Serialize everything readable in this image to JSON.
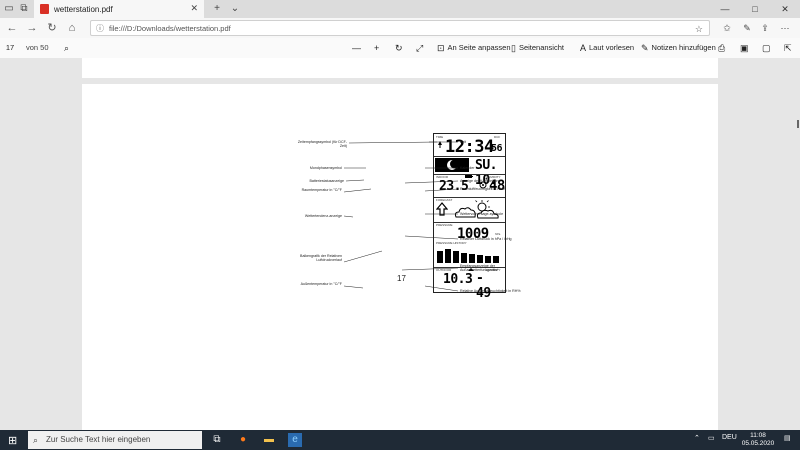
{
  "browser": {
    "tab_title": "wetterstation.pdf",
    "url": "file:///D:/Downloads/wetterstation.pdf"
  },
  "pdf_toolbar": {
    "page_current": "17",
    "page_total": "von 50",
    "fit_label": "An Seite anpassen",
    "page_view_label": "Seitenansicht",
    "read_aloud_label": "Laut vorlesen",
    "notes_label": "Notizen hinzufügen"
  },
  "document": {
    "page_number": "17",
    "device": {
      "time_label": "TIME",
      "dcf_label": "DCF",
      "time": "12:34",
      "seconds": "56",
      "weekday_date": "SU. 10.",
      "indoor_label": "INDOOR",
      "humidity_label": "HUMIDITY",
      "indoor_temp": "23.5",
      "indoor_humidity": "48",
      "forecast_label": "FORECAST",
      "pressure_label": "PRESSURE",
      "pressure_value": "1009",
      "pressure_unit": "hPa",
      "history_label": "PRESSURE HISTORY",
      "outdoor_label": "OUTDOOR",
      "outdoor_humidity_label": "HUMIDITY",
      "outdoor_temp": "10.3",
      "outdoor_humidity": "- 49"
    },
    "callouts_left": [
      "Zeitempfangssymbol (für DCF-Zeit)",
      "Mondphasensymbol",
      "Batteriestatusanzeige",
      "Raumtemperatur in °C/°F",
      "Wettertendenz-anzeige",
      "Balkengrafik der Relativen Luftdruckverlauf",
      "Außentemperatur in °C/°F"
    ],
    "callouts_right": [
      "Zeit",
      "Kalender",
      "Anzeige der Komfortzone",
      "Raumluftfeuchtigkeit in RH%",
      "Wettervorhersage-symbole",
      "Relativer Luftdruck in hPa / inHg",
      "Empfangsanzeige der Außenwetterfunkgeräts*",
      "Relative Außenluftfeuchtigkeit in RH%"
    ]
  },
  "taskbar": {
    "search_placeholder": "Zur Suche Text hier eingeben",
    "language": "DEU",
    "time": "11:08",
    "date": "05.05.2020"
  }
}
